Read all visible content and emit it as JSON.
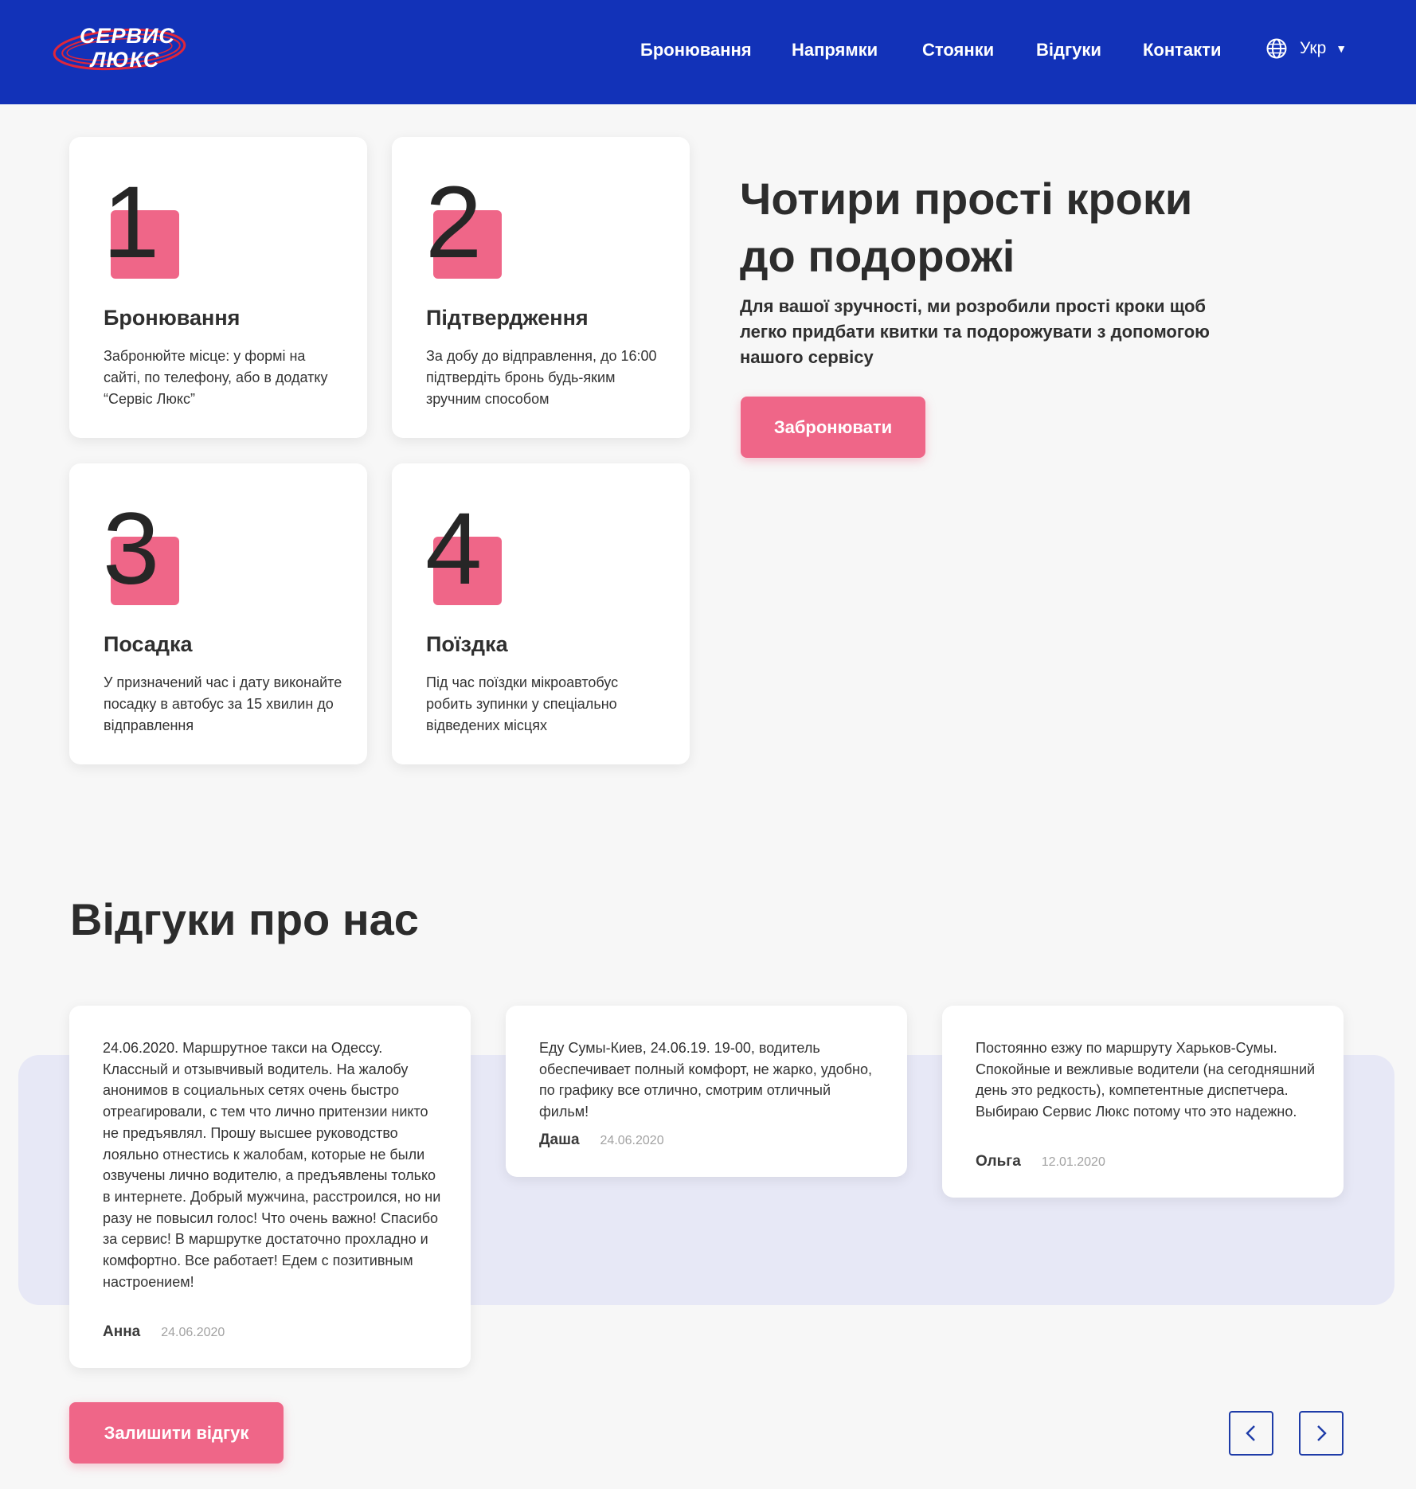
{
  "header": {
    "logo_line1": "СЕРВИС",
    "logo_line2": "ЛЮКС",
    "nav": [
      {
        "label": "Бронювання"
      },
      {
        "label": "Напрямки"
      },
      {
        "label": "Стоянки"
      },
      {
        "label": "Відгуки"
      },
      {
        "label": "Контакти"
      }
    ],
    "language": "Укр",
    "language_icon": "globe-icon",
    "brand_color": "#1232b8",
    "accent_color": "#ef6688"
  },
  "steps": [
    {
      "number": "1",
      "title": "Бронювання",
      "text": "Забронюйте місце: у формі на сайті, по телефону, або в додатку “Сервіс Люкс”"
    },
    {
      "number": "2",
      "title": "Підтвердження",
      "text": "За добу до відправлення, до 16:00 підтвердіть бронь будь-яким зручним способом"
    },
    {
      "number": "3",
      "title": "Посадка",
      "text": "У призначений час і дату виконайте посадку в автобус за 15 хвилин до відправлення"
    },
    {
      "number": "4",
      "title": "Поїздка",
      "text": "Під час поїздки мікроавтобус робить зупинки у спеціально відведених місцях"
    }
  ],
  "hero": {
    "title": "Чотири прості кроки до подорожі",
    "subtitle": "Для вашої зручності, ми розробили прості кроки щоб легко придбати квитки та подорожувати з допомогою нашого сервісу",
    "button": "Забронювати"
  },
  "reviews": {
    "title": "Відгуки про нас",
    "items": [
      {
        "text": "24.06.2020. Маршрутное такси на Одессу. Классный и отзывчивый водитель. На жалобу анонимов в социальных сетях очень быстро отреагировали, с тем что лично притензии никто не предъявлял. Прошу высшее руководство лояльно отнестись к жалобам, которые не были озвучены лично водителю, а предъявлены только в интернете. Добрый мужчина, расстроился, но ни разу не повысил голос! Что очень важно! Спасибо за сервис! В маршрутке достаточно прохладно и комфортно. Все работает! Едем с позитивным настроением!",
        "author": "Анна",
        "date": "24.06.2020"
      },
      {
        "text": "Еду Сумы-Киев, 24.06.19. 19-00, водитель обеспечивает полный комфорт, не жарко, удобно, по графику все отлично, смотрим отличный фильм!",
        "author": "Даша",
        "date": "24.06.2020"
      },
      {
        "text": "Постоянно езжу по маршруту Харьков-Сумы. Спокойные и вежливые водители (на сегодняшний день это редкость), компетентные диспетчера. Выбираю Сервис Люкс потому что это надежно.",
        "author": "Ольга",
        "date": "12.01.2020"
      }
    ],
    "leave_button": "Залишити відгук",
    "prev_icon": "chevron-left-icon",
    "next_icon": "chevron-right-icon"
  }
}
